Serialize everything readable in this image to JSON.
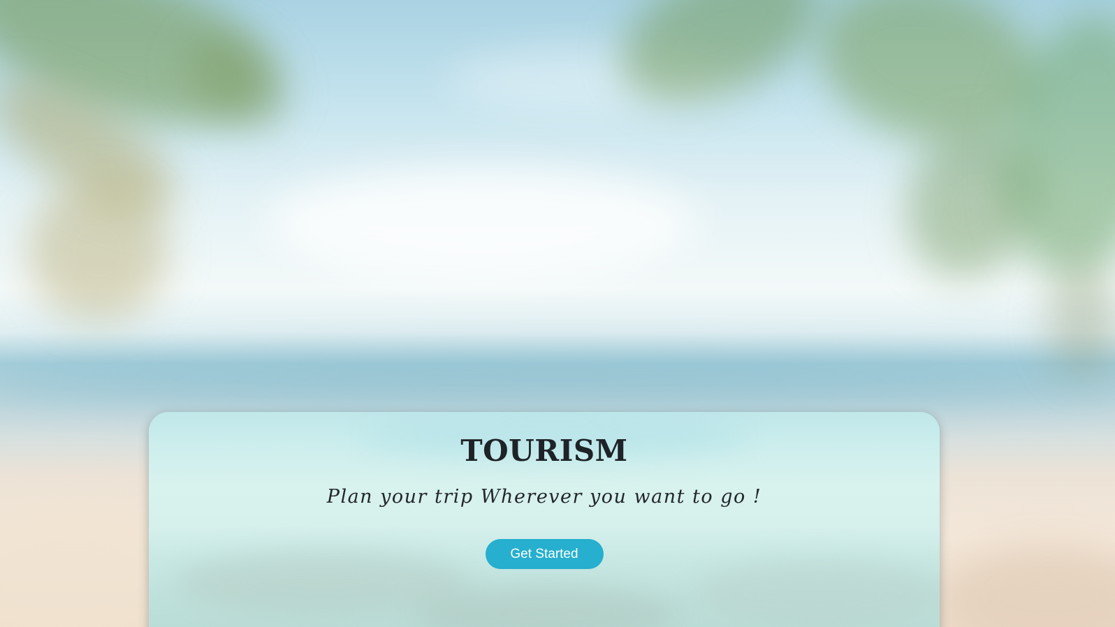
{
  "hero": {
    "title": "TOURISM",
    "tagline": "Plan your trip Wherever you want to go !",
    "cta_label": "Get Started"
  },
  "colors": {
    "cta_background": "#26afce",
    "cta_text": "#ffffff",
    "title_text": "#1e2328"
  },
  "background": {
    "scene": "beach-background-image"
  }
}
